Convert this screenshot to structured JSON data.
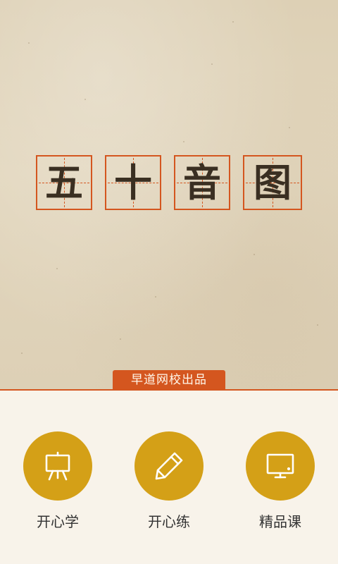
{
  "title_chars": [
    "五",
    "十",
    "音",
    "图"
  ],
  "publisher_badge": "早道网校出品",
  "menu": [
    {
      "label": "开心学",
      "icon": "easel-icon"
    },
    {
      "label": "开心练",
      "icon": "pencil-icon"
    },
    {
      "label": "精品课",
      "icon": "monitor-icon"
    }
  ],
  "colors": {
    "accent": "#d4561f",
    "icon_circle": "#d4a017",
    "paper": "#ddd0b5",
    "bottom_bg": "#f8f3ea"
  }
}
